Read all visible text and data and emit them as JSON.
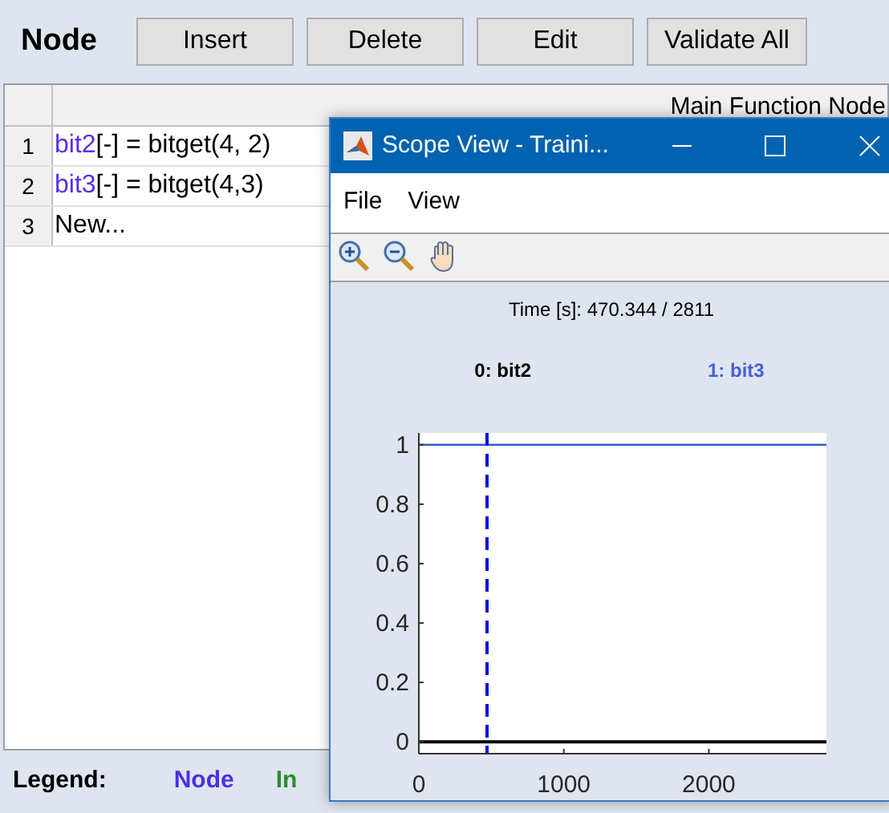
{
  "toolbar": {
    "title": "Node",
    "buttons": [
      "Insert",
      "Delete",
      "Edit",
      "Validate All"
    ]
  },
  "table": {
    "columns": [
      "Main Function Node"
    ],
    "rows": [
      {
        "number": "1",
        "name": "bit2",
        "rest": "[-] = bitget(4, 2)"
      },
      {
        "number": "2",
        "name": "bit3",
        "rest": "[-] = bitget(4,3)"
      },
      {
        "number": "3",
        "name": "",
        "rest": "New..."
      }
    ]
  },
  "legend": {
    "label": "Legend:",
    "items": [
      {
        "label": "Node",
        "color": "#4b2fe3"
      },
      {
        "label": "In",
        "color": "#2e8b2e"
      }
    ]
  },
  "scope_window": {
    "title": "Scope View - Traini...",
    "menu": [
      "File",
      "View"
    ],
    "time": "Time [s]: 470.344 / 2811",
    "signals": [
      {
        "index": "0:",
        "color": "#000000"
      },
      {
        "index": "1:",
        "color": "#4a5fd6"
      }
    ],
    "chart_data": {
      "type": "line",
      "x": [
        0,
        2811
      ],
      "series": [
        {
          "name": "bit2",
          "color": "#000000",
          "values": [
            0,
            0
          ]
        },
        {
          "name": "bit3",
          "color": "#2f5fd0",
          "values": [
            1,
            1
          ]
        }
      ],
      "xlim": [
        0,
        2811
      ],
      "ylim": [
        -0.04,
        1.04
      ],
      "xticks": [
        0,
        1000,
        2000
      ],
      "yticks": [
        0,
        0.2,
        0.4,
        0.6,
        0.8,
        1
      ],
      "ref_lines": [
        {
          "axis": "x",
          "value": 470.344,
          "color": "#1010e0"
        }
      ]
    }
  }
}
